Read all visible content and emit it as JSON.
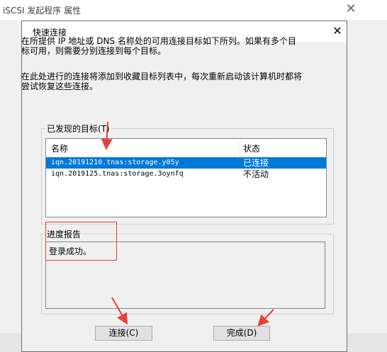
{
  "parent_window": {
    "title": "iSCSI 发起程序 属性",
    "close_glyph": "✕"
  },
  "dialog": {
    "title": "快速连接",
    "close_glyph": "✕",
    "paragraph1_line1": "在所提供 IP 地址或 DNS 名称处的可用连接目标如下所列。如果有多个目",
    "paragraph1_line2": "标可用，则需要分别连接到每个目标。",
    "paragraph2_line1": "在此处进行的连接将添加到收藏目标列表中，每次重新启动该计算机时都将",
    "paragraph2_line2": "尝试恢复这些连接。",
    "targets_group_label": "已发现的目标(T)",
    "targets_table": {
      "columns": [
        "名称",
        "状态"
      ],
      "rows": [
        {
          "name": "iqn.20191210.tnas:storage.y05y",
          "status": "已连接",
          "selected": true
        },
        {
          "name": "iqn.2019125.tnas:storage.3oynfq",
          "status": "不活动",
          "selected": false
        }
      ]
    },
    "progress_group_label": "进度报告",
    "progress_text": "登录成功。",
    "buttons": {
      "connect": "连接(C)",
      "done": "完成(D)"
    }
  },
  "colors": {
    "selection": "#0078d7",
    "annotation_red": "#e8413b"
  }
}
